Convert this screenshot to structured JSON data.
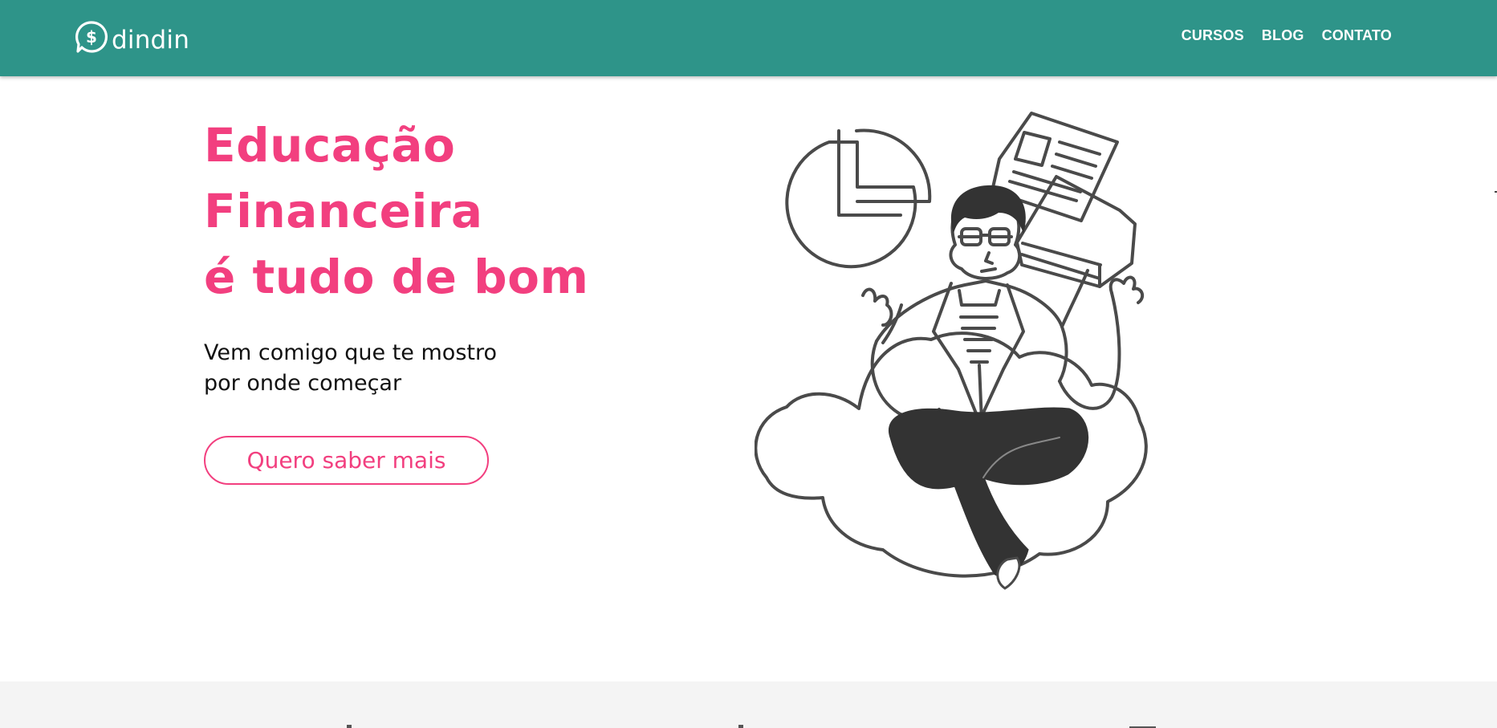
{
  "brand": {
    "name": "dindin",
    "logo_icon": "dollar-speech-bubble-icon"
  },
  "nav": {
    "items": [
      {
        "label": "CURSOS"
      },
      {
        "label": "BLOG"
      },
      {
        "label": "CONTATO"
      }
    ]
  },
  "hero": {
    "title_lines": [
      "Educação",
      "Financeira",
      "é tudo de bom"
    ],
    "subtitle_lines": [
      "Vem comigo que te mostro",
      "por onde começar"
    ],
    "cta_label": "Quero saber mais",
    "illustration": "person-meditating-on-cloud-with-pie-chart-and-documents"
  },
  "colors": {
    "header_bg": "#2e9489",
    "accent_pink": "#f23f7f",
    "text_dark": "#111111",
    "section_gray": "#f4f4f4",
    "illustration_stroke": "#4a4a4a"
  }
}
